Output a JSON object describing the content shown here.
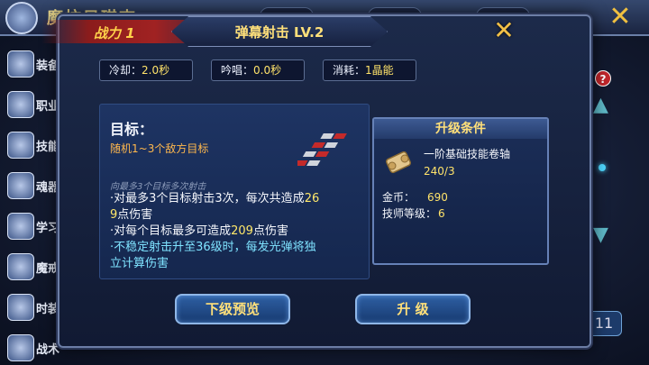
{
  "background": {
    "title": "魔抗目琪查",
    "sidebar": [
      {
        "label": "装备"
      },
      {
        "label": "职业"
      },
      {
        "label": "技能"
      },
      {
        "label": "魂器"
      },
      {
        "label": "学习"
      },
      {
        "label": "魔戒"
      },
      {
        "label": "时装"
      },
      {
        "label": "战术"
      }
    ],
    "right_button": "11"
  },
  "modal": {
    "power_label": "战力 1",
    "skill_title": "弹幕射击 LV.2",
    "stats": {
      "cooldown_label": "冷却：",
      "cooldown_value": "2.0秒",
      "chant_label": "吟唱：",
      "chant_value": "0.0秒",
      "cost_label": "消耗：",
      "cost_value": "1晶能"
    },
    "target": {
      "title": "目标：",
      "desc": "随机1~3个敌方目标"
    },
    "sub_caption": "向最多3个目标多次射击",
    "effects": {
      "line1_a": "·对最多3个目标射击3次，每次共造成",
      "line1_num": "26",
      "line2_num": "9",
      "line2_b": "点伤害",
      "line3_a": "·对每个目标最多可造成",
      "line3_num": "209",
      "line3_b": "点伤害",
      "line4": "·不稳定射击升至36级时，每发光弹将独",
      "line5": "立计算伤害"
    },
    "upgrade": {
      "title": "升级条件",
      "item_name": "一阶基础技能卷轴",
      "item_count": "240/3",
      "gold_label": "金币：",
      "gold_value": "690",
      "level_label": "技师等级：",
      "level_value": "6"
    },
    "buttons": {
      "preview": "下级预览",
      "upgrade": "升 级"
    }
  }
}
